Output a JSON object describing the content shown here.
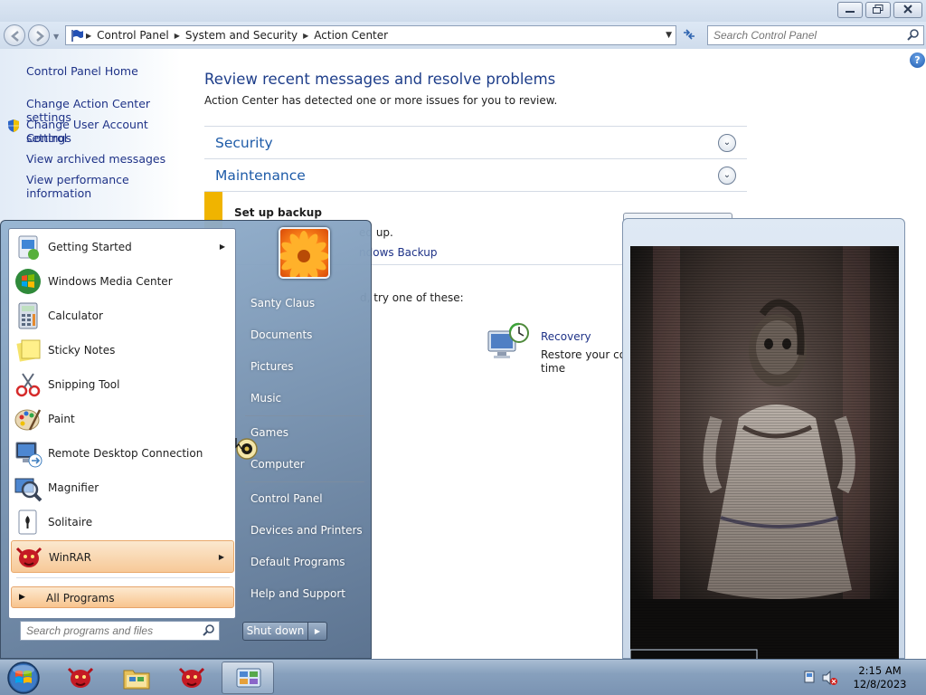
{
  "window": {
    "minimize_glyph": "—",
    "address": {
      "crumbs": [
        "Control Panel",
        "System and Security",
        "Action Center"
      ]
    },
    "search_placeholder": "Search Control Panel",
    "help_glyph": "?"
  },
  "sidebar": {
    "items": [
      "Control Panel Home",
      "Change Action Center settings",
      "Change User Account Control",
      "settings",
      "View archived messages",
      "View performance information"
    ]
  },
  "main": {
    "title": "Review recent messages and resolve problems",
    "subtitle": "Action Center has detected one or more issues for you to review.",
    "sections": [
      "Security",
      "Maintenance"
    ],
    "alert": {
      "title": "Set up backup",
      "text": "ed up.",
      "link": "ndows Backup"
    },
    "try_text": "d, try one of these:",
    "recovery": {
      "link": "Recovery",
      "desc_line1": "Restore your com",
      "desc_line2": "time"
    }
  },
  "start_menu": {
    "programs": [
      {
        "label": "Getting Started",
        "icon": "getting-started-icon",
        "arrow": true
      },
      {
        "label": "Windows Media Center",
        "icon": "media-center-icon",
        "arrow": false
      },
      {
        "label": "Calculator",
        "icon": "calculator-icon",
        "arrow": false
      },
      {
        "label": "Sticky Notes",
        "icon": "sticky-notes-icon",
        "arrow": false
      },
      {
        "label": "Snipping Tool",
        "icon": "snipping-tool-icon",
        "arrow": false
      },
      {
        "label": "Paint",
        "icon": "paint-icon",
        "arrow": false
      },
      {
        "label": "Remote Desktop Connection",
        "icon": "remote-desktop-icon",
        "arrow": false
      },
      {
        "label": "Magnifier",
        "icon": "magnifier-icon",
        "arrow": false
      },
      {
        "label": "Solitaire",
        "icon": "solitaire-icon",
        "arrow": false
      },
      {
        "label": "WinRAR",
        "icon": "winrar-icon",
        "arrow": true,
        "selected": true
      }
    ],
    "all_programs": "All Programs",
    "search_placeholder": "Search programs and files",
    "places": [
      "Santy Claus",
      "Documents",
      "Pictures",
      "Music",
      "Games",
      "Computer",
      "Control Panel",
      "Devices and Printers",
      "Default Programs",
      "Help and Support"
    ],
    "shutdown": "Shut down"
  },
  "taskbar": {
    "time": "2:15 AM",
    "date": "12/8/2023"
  },
  "colors": {
    "link": "#1e3287",
    "title": "#1e3e8a",
    "alert_bar": "#f0b400",
    "taskbar": "#87a0bd"
  }
}
